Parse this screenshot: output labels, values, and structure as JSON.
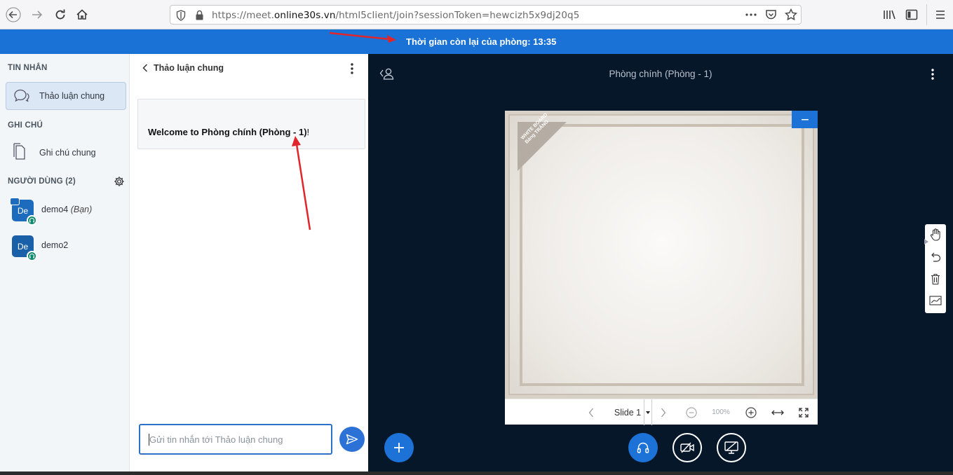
{
  "browser": {
    "url_prefix": "https://meet.",
    "url_domain": "online30s.vn",
    "url_path": "/html5client/join?sessionToken=hewcizh5x9dj20q5"
  },
  "banner": {
    "text": "Thời gian còn lại của phòng: 13:35"
  },
  "sidebar": {
    "messages_title": "TIN NHẮN",
    "public_chat": "Thảo luận chung",
    "notes_title": "GHI CHÚ",
    "shared_notes": "Ghi chú chung",
    "users_title": "NGƯỜI DÙNG (2)",
    "users": [
      {
        "initials": "De",
        "name": "demo4",
        "tag": "(Bạn)"
      },
      {
        "initials": "De",
        "name": "demo2",
        "tag": ""
      }
    ]
  },
  "chat": {
    "header": "Thảo luận chung",
    "welcome_prefix": "Welcome to ",
    "welcome_room": "Phòng chính (Phòng - 1)",
    "welcome_suffix": "!",
    "input_placeholder": "Gửi tin nhắn tới Thảo luận chung"
  },
  "main": {
    "room_title": "Phòng chính (Phòng - 1)",
    "whiteboard_tag_1": "WHITE BOARD",
    "whiteboard_tag_2": "Bảng TRẮNG",
    "slide_label": "Slide 1",
    "zoom": "100%"
  },
  "colors": {
    "accent": "#1c72d6",
    "banner": "#1b72d6",
    "main_bg": "#06172a",
    "annotation_arrow": "#e0262b"
  }
}
